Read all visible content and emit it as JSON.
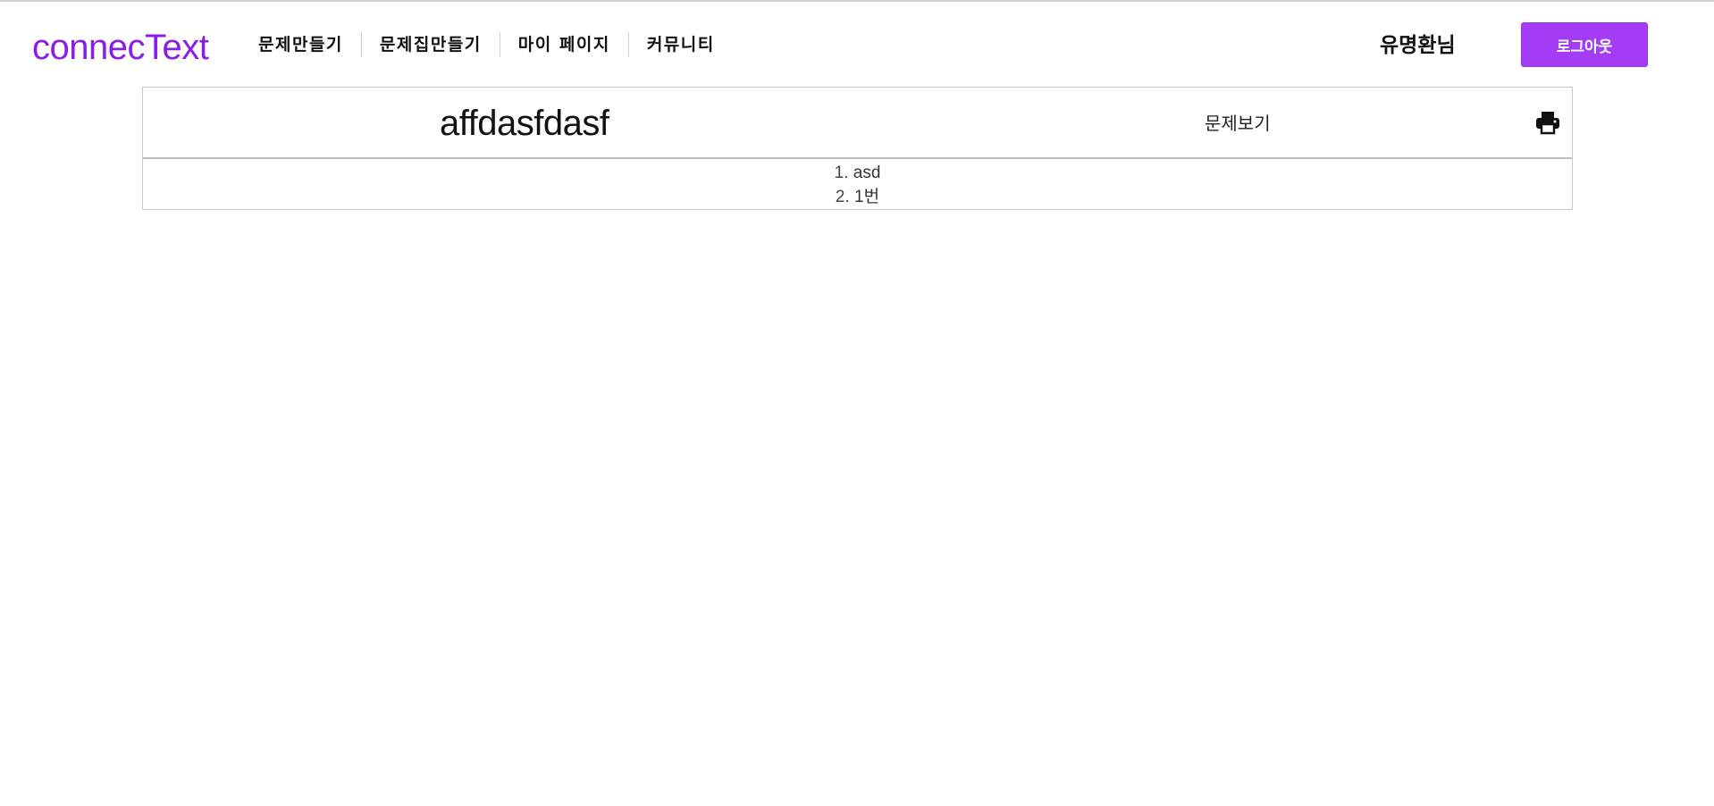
{
  "header": {
    "logo": "connecText",
    "nav": [
      {
        "label": "문제만들기"
      },
      {
        "label": "문제집만들기"
      },
      {
        "label": "마이 페이지"
      },
      {
        "label": "커뮤니티"
      }
    ],
    "user_greeting": "유명환님",
    "logout_label": "로그아웃"
  },
  "panel": {
    "title": "affdasfdasf",
    "view_label": "문제보기",
    "print_icon": "print-icon",
    "questions": [
      {
        "number": "1.",
        "text": "asd"
      },
      {
        "number": "2.",
        "text": "1번"
      }
    ]
  },
  "colors": {
    "brand": "#8a1ee8",
    "button": "#a53cf5"
  }
}
